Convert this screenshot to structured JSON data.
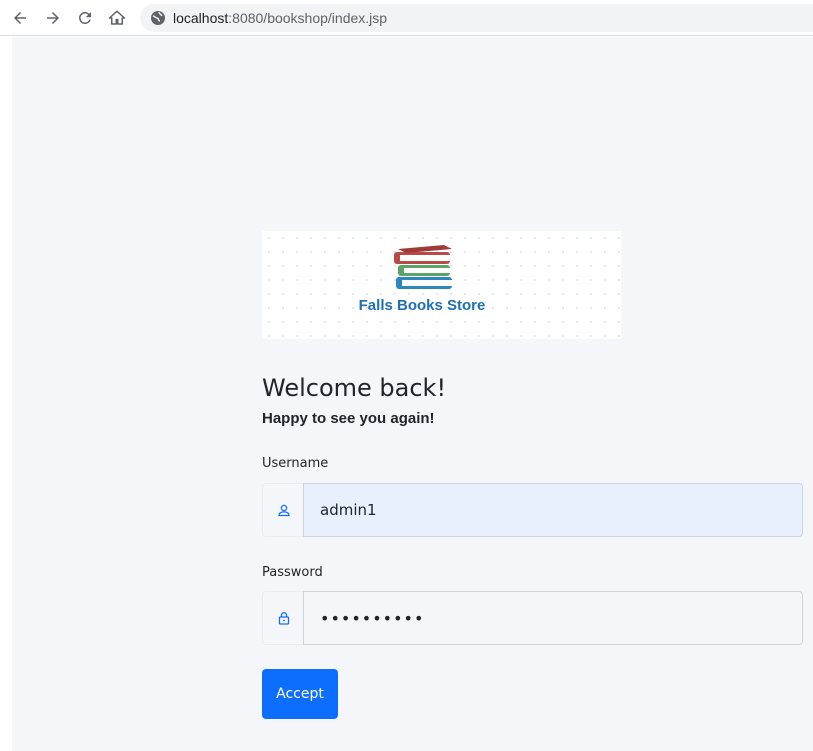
{
  "browser": {
    "url_host": "localhost",
    "url_path": ":8080/bookshop/index.jsp",
    "icons": [
      "back-icon",
      "forward-icon",
      "reload-icon",
      "home-icon",
      "site-info-icon"
    ]
  },
  "logo": {
    "text": "Falls Books Store"
  },
  "login": {
    "title": "Welcome back!",
    "subtitle": "Happy to see you again!",
    "username_label": "Username",
    "username_value": "admin1",
    "password_label": "Password",
    "password_value": "••••••••••",
    "submit_label": "Accept"
  },
  "colors": {
    "primary": "#0d6efd",
    "page_bg": "#f5f6fa",
    "autofill_bg": "#e8f0fe",
    "logo_text": "#1f6fb3"
  }
}
